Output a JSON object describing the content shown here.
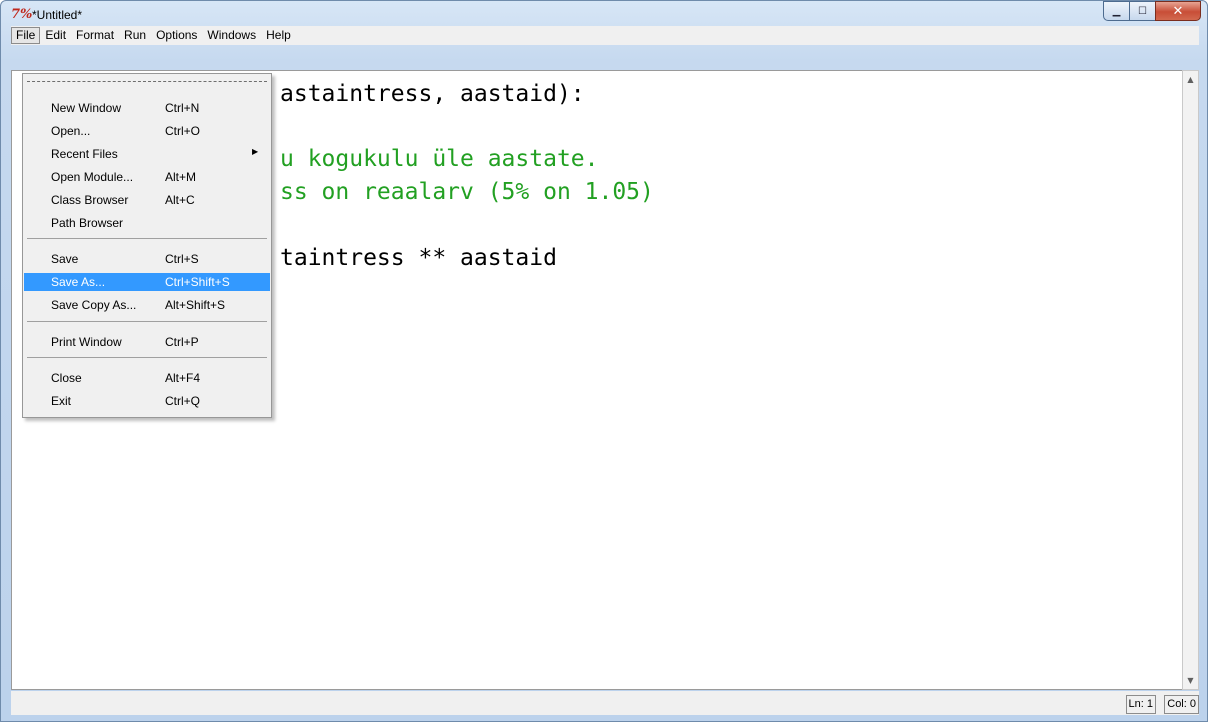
{
  "window": {
    "title": "*Untitled*",
    "app_icon": "7%"
  },
  "menubar": {
    "items": [
      "File",
      "Edit",
      "Format",
      "Run",
      "Options",
      "Windows",
      "Help"
    ]
  },
  "editor": {
    "lines": [
      {
        "text": "astaintress, aastaid):",
        "color": "#000000"
      },
      {
        "text": "u kogukulu üle aastate.",
        "color": "#22a022"
      },
      {
        "text": "ss on reaalarv (5% on 1.05)",
        "color": "#22a022"
      },
      {
        "text": "taintress ** aastaid",
        "color": "#000000"
      }
    ]
  },
  "file_menu": {
    "tearoff": "----------",
    "items": [
      {
        "label": "New Window",
        "accel": "Ctrl+N"
      },
      {
        "label": "Open...",
        "accel": "Ctrl+O"
      },
      {
        "label": "Recent Files",
        "accel": ""
      },
      {
        "label": "Open Module...",
        "accel": "Alt+M"
      },
      {
        "label": "Class Browser",
        "accel": "Alt+C"
      },
      {
        "label": "Path Browser",
        "accel": ""
      },
      {
        "label": "Save",
        "accel": "Ctrl+S"
      },
      {
        "label": "Save As...",
        "accel": "Ctrl+Shift+S"
      },
      {
        "label": "Save Copy As...",
        "accel": "Alt+Shift+S"
      },
      {
        "label": "Print Window",
        "accel": "Ctrl+P"
      },
      {
        "label": "Close",
        "accel": "Alt+F4"
      },
      {
        "label": "Exit",
        "accel": "Ctrl+Q"
      }
    ],
    "highlighted": "Save As..."
  },
  "statusbar": {
    "ln": "Ln: 1",
    "col": "Col: 0"
  },
  "colors": {
    "highlight": "#3399ff",
    "string_green": "#22a022",
    "close_button": "#c84e37"
  }
}
